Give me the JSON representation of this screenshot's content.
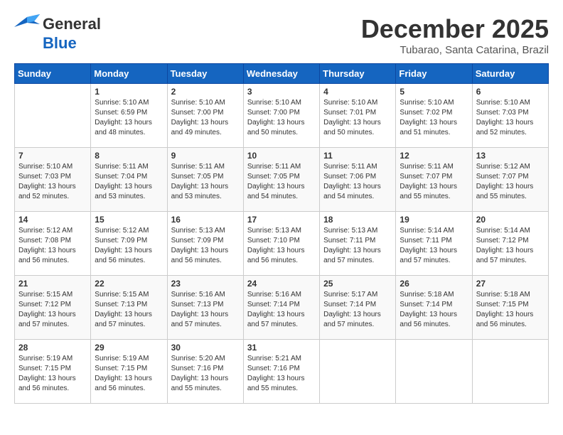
{
  "header": {
    "logo_line1": "General",
    "logo_line2": "Blue",
    "month_title": "December 2025",
    "location": "Tubarao, Santa Catarina, Brazil"
  },
  "days_of_week": [
    "Sunday",
    "Monday",
    "Tuesday",
    "Wednesday",
    "Thursday",
    "Friday",
    "Saturday"
  ],
  "weeks": [
    [
      {
        "day": "",
        "info": ""
      },
      {
        "day": "1",
        "info": "Sunrise: 5:10 AM\nSunset: 6:59 PM\nDaylight: 13 hours\nand 48 minutes."
      },
      {
        "day": "2",
        "info": "Sunrise: 5:10 AM\nSunset: 7:00 PM\nDaylight: 13 hours\nand 49 minutes."
      },
      {
        "day": "3",
        "info": "Sunrise: 5:10 AM\nSunset: 7:00 PM\nDaylight: 13 hours\nand 50 minutes."
      },
      {
        "day": "4",
        "info": "Sunrise: 5:10 AM\nSunset: 7:01 PM\nDaylight: 13 hours\nand 50 minutes."
      },
      {
        "day": "5",
        "info": "Sunrise: 5:10 AM\nSunset: 7:02 PM\nDaylight: 13 hours\nand 51 minutes."
      },
      {
        "day": "6",
        "info": "Sunrise: 5:10 AM\nSunset: 7:03 PM\nDaylight: 13 hours\nand 52 minutes."
      }
    ],
    [
      {
        "day": "7",
        "info": "Sunrise: 5:10 AM\nSunset: 7:03 PM\nDaylight: 13 hours\nand 52 minutes."
      },
      {
        "day": "8",
        "info": "Sunrise: 5:11 AM\nSunset: 7:04 PM\nDaylight: 13 hours\nand 53 minutes."
      },
      {
        "day": "9",
        "info": "Sunrise: 5:11 AM\nSunset: 7:05 PM\nDaylight: 13 hours\nand 53 minutes."
      },
      {
        "day": "10",
        "info": "Sunrise: 5:11 AM\nSunset: 7:05 PM\nDaylight: 13 hours\nand 54 minutes."
      },
      {
        "day": "11",
        "info": "Sunrise: 5:11 AM\nSunset: 7:06 PM\nDaylight: 13 hours\nand 54 minutes."
      },
      {
        "day": "12",
        "info": "Sunrise: 5:11 AM\nSunset: 7:07 PM\nDaylight: 13 hours\nand 55 minutes."
      },
      {
        "day": "13",
        "info": "Sunrise: 5:12 AM\nSunset: 7:07 PM\nDaylight: 13 hours\nand 55 minutes."
      }
    ],
    [
      {
        "day": "14",
        "info": "Sunrise: 5:12 AM\nSunset: 7:08 PM\nDaylight: 13 hours\nand 56 minutes."
      },
      {
        "day": "15",
        "info": "Sunrise: 5:12 AM\nSunset: 7:09 PM\nDaylight: 13 hours\nand 56 minutes."
      },
      {
        "day": "16",
        "info": "Sunrise: 5:13 AM\nSunset: 7:09 PM\nDaylight: 13 hours\nand 56 minutes."
      },
      {
        "day": "17",
        "info": "Sunrise: 5:13 AM\nSunset: 7:10 PM\nDaylight: 13 hours\nand 56 minutes."
      },
      {
        "day": "18",
        "info": "Sunrise: 5:13 AM\nSunset: 7:11 PM\nDaylight: 13 hours\nand 57 minutes."
      },
      {
        "day": "19",
        "info": "Sunrise: 5:14 AM\nSunset: 7:11 PM\nDaylight: 13 hours\nand 57 minutes."
      },
      {
        "day": "20",
        "info": "Sunrise: 5:14 AM\nSunset: 7:12 PM\nDaylight: 13 hours\nand 57 minutes."
      }
    ],
    [
      {
        "day": "21",
        "info": "Sunrise: 5:15 AM\nSunset: 7:12 PM\nDaylight: 13 hours\nand 57 minutes."
      },
      {
        "day": "22",
        "info": "Sunrise: 5:15 AM\nSunset: 7:13 PM\nDaylight: 13 hours\nand 57 minutes."
      },
      {
        "day": "23",
        "info": "Sunrise: 5:16 AM\nSunset: 7:13 PM\nDaylight: 13 hours\nand 57 minutes."
      },
      {
        "day": "24",
        "info": "Sunrise: 5:16 AM\nSunset: 7:14 PM\nDaylight: 13 hours\nand 57 minutes."
      },
      {
        "day": "25",
        "info": "Sunrise: 5:17 AM\nSunset: 7:14 PM\nDaylight: 13 hours\nand 57 minutes."
      },
      {
        "day": "26",
        "info": "Sunrise: 5:18 AM\nSunset: 7:14 PM\nDaylight: 13 hours\nand 56 minutes."
      },
      {
        "day": "27",
        "info": "Sunrise: 5:18 AM\nSunset: 7:15 PM\nDaylight: 13 hours\nand 56 minutes."
      }
    ],
    [
      {
        "day": "28",
        "info": "Sunrise: 5:19 AM\nSunset: 7:15 PM\nDaylight: 13 hours\nand 56 minutes."
      },
      {
        "day": "29",
        "info": "Sunrise: 5:19 AM\nSunset: 7:15 PM\nDaylight: 13 hours\nand 56 minutes."
      },
      {
        "day": "30",
        "info": "Sunrise: 5:20 AM\nSunset: 7:16 PM\nDaylight: 13 hours\nand 55 minutes."
      },
      {
        "day": "31",
        "info": "Sunrise: 5:21 AM\nSunset: 7:16 PM\nDaylight: 13 hours\nand 55 minutes."
      },
      {
        "day": "",
        "info": ""
      },
      {
        "day": "",
        "info": ""
      },
      {
        "day": "",
        "info": ""
      }
    ]
  ]
}
